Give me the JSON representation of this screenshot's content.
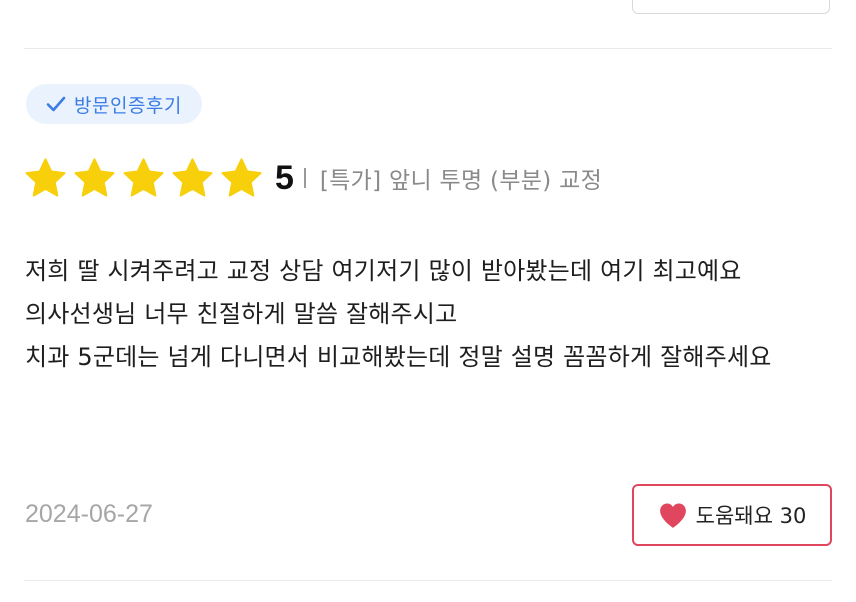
{
  "badge": {
    "label": "방문인증후기",
    "icon": "check-icon",
    "color": "#3a7be6"
  },
  "rating": {
    "stars": 5,
    "max_stars": 5,
    "score": "5",
    "treatment": "[특가] 앞니 투명 (부분) 교정",
    "star_color": "#f7cf0b"
  },
  "review": {
    "lines": [
      "저희 딸 시켜주려고 교정 상담 여기저기 많이 받아봤는데 여기 최고예요",
      "의사선생님 너무 친절하게 말씀 잘해주시고",
      "치과 5군데는 넘게 다니면서 비교해봤는데 정말 설명 꼼꼼하게 잘해주세요"
    ]
  },
  "date": "2024-06-27",
  "helpful": {
    "label": "도움돼요 30",
    "icon": "heart-icon",
    "color": "#e0475e"
  }
}
